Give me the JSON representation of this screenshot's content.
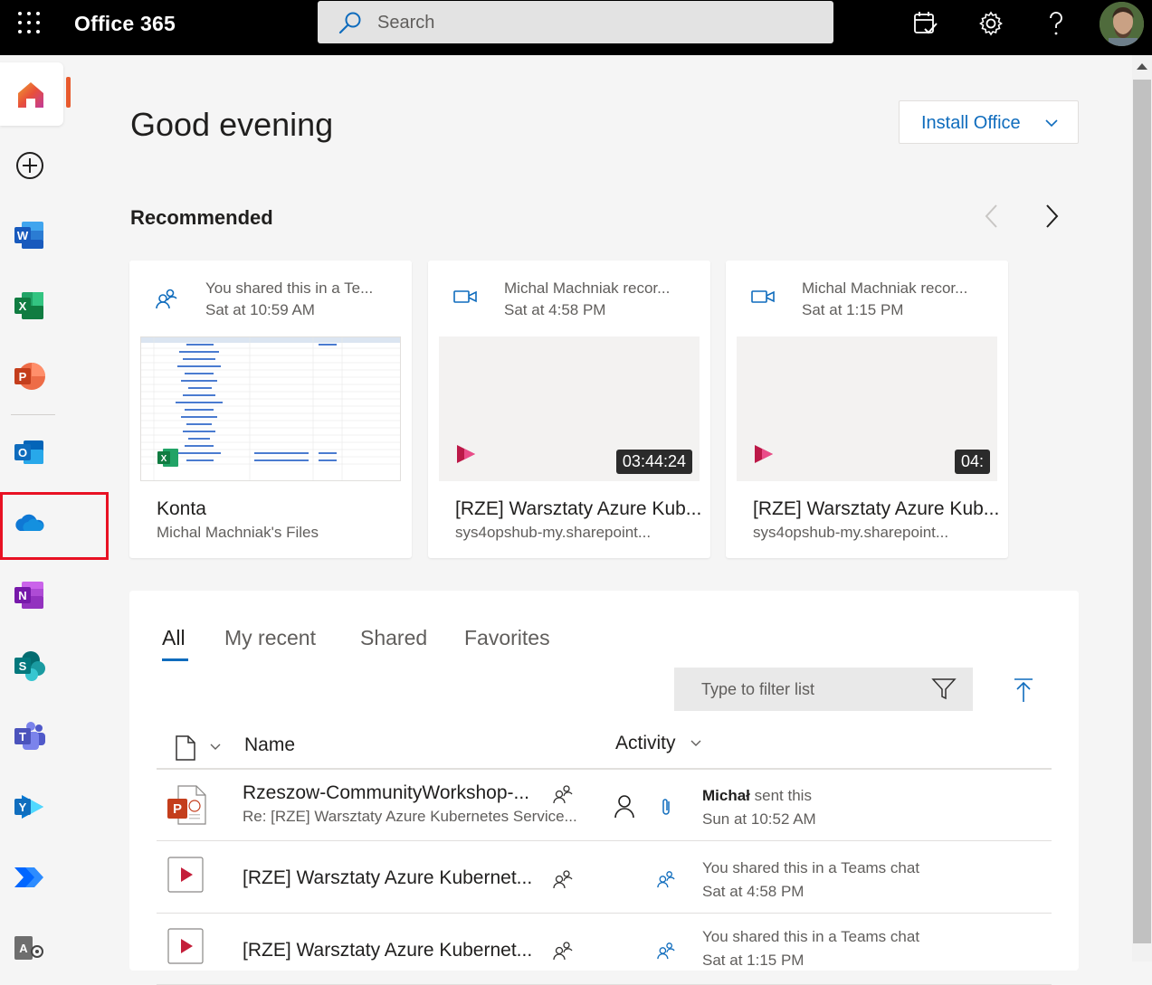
{
  "topbar": {
    "brand": "Office 365",
    "search_placeholder": "Search",
    "icons": [
      "waffle-icon",
      "search-icon",
      "calendar-check-icon",
      "gear-icon",
      "help-icon",
      "avatar"
    ]
  },
  "rail": {
    "items": [
      {
        "name": "home",
        "icon": "home-icon",
        "active": true
      },
      {
        "name": "create",
        "icon": "plus-circle-icon"
      },
      {
        "name": "word",
        "letter": "W",
        "color": "#185abd"
      },
      {
        "name": "excel",
        "letter": "X",
        "color": "#107c41"
      },
      {
        "name": "powerpoint",
        "letter": "P",
        "color": "#c43e1c"
      },
      {
        "name": "outlook",
        "letter": "O",
        "color": "#0f6cbd"
      },
      {
        "name": "onedrive",
        "icon": "cloud-icon",
        "highlighted": true
      },
      {
        "name": "onenote",
        "letter": "N",
        "color": "#7719aa"
      },
      {
        "name": "sharepoint",
        "letter": "S",
        "color": "#03787c"
      },
      {
        "name": "teams",
        "letter": "T",
        "color": "#5059c9"
      },
      {
        "name": "yammer",
        "letter": "Y",
        "color": "#106ebe"
      },
      {
        "name": "power-automate",
        "icon": "power-automate-icon"
      },
      {
        "name": "admin",
        "letter": "A",
        "color": "#6e6e6e"
      }
    ]
  },
  "main": {
    "greeting": "Good evening",
    "install_label": "Install Office",
    "recommended_title": "Recommended",
    "cards": [
      {
        "line1": "You shared this in a Te...",
        "line2": "Sat at 10:59 AM",
        "name": "Konta",
        "location": "Michal Machniak's Files",
        "icon": "people-icon",
        "duration": ""
      },
      {
        "line1": "Michal Machniak recor...",
        "line2": "Sat at 4:58 PM",
        "name": "[RZE] Warsztaty Azure Kub...",
        "location": "sys4opshub-my.sharepoint...",
        "icon": "video-icon",
        "duration": "03:44:24"
      },
      {
        "line1": "Michal Machniak recor...",
        "line2": "Sat at 1:15 PM",
        "name": "[RZE] Warsztaty Azure Kub...",
        "location": "sys4opshub-my.sharepoint...",
        "icon": "video-icon",
        "duration": "04:"
      }
    ],
    "tabs": [
      "All",
      "My recent",
      "Shared",
      "Favorites"
    ],
    "filter_placeholder": "Type to filter list",
    "columns": {
      "name": "Name",
      "activity": "Activity"
    },
    "rows": [
      {
        "name": "Rzeszow-CommunityWorkshop-...",
        "sub": "Re: [RZE] Warsztaty Azure Kubernetes Service...",
        "activity_actor": "Michał",
        "activity_action": " sent this",
        "activity_time": "Sun at 10:52 AM",
        "type": "pptx"
      },
      {
        "name": "[RZE] Warsztaty Azure Kubernet...",
        "sub": "",
        "activity_actor": "",
        "activity_action": "You shared this in a Teams chat",
        "activity_time": "Sat at 4:58 PM",
        "type": "video"
      },
      {
        "name": "[RZE] Warsztaty Azure Kubernet...",
        "sub": "",
        "activity_actor": "",
        "activity_action": "You shared this in a Teams chat",
        "activity_time": "Sat at 1:15 PM",
        "type": "video"
      }
    ]
  },
  "colors": {
    "accent": "#0f6cbd",
    "highlight": "#e81123",
    "home_indicator": "#e85a2d"
  }
}
